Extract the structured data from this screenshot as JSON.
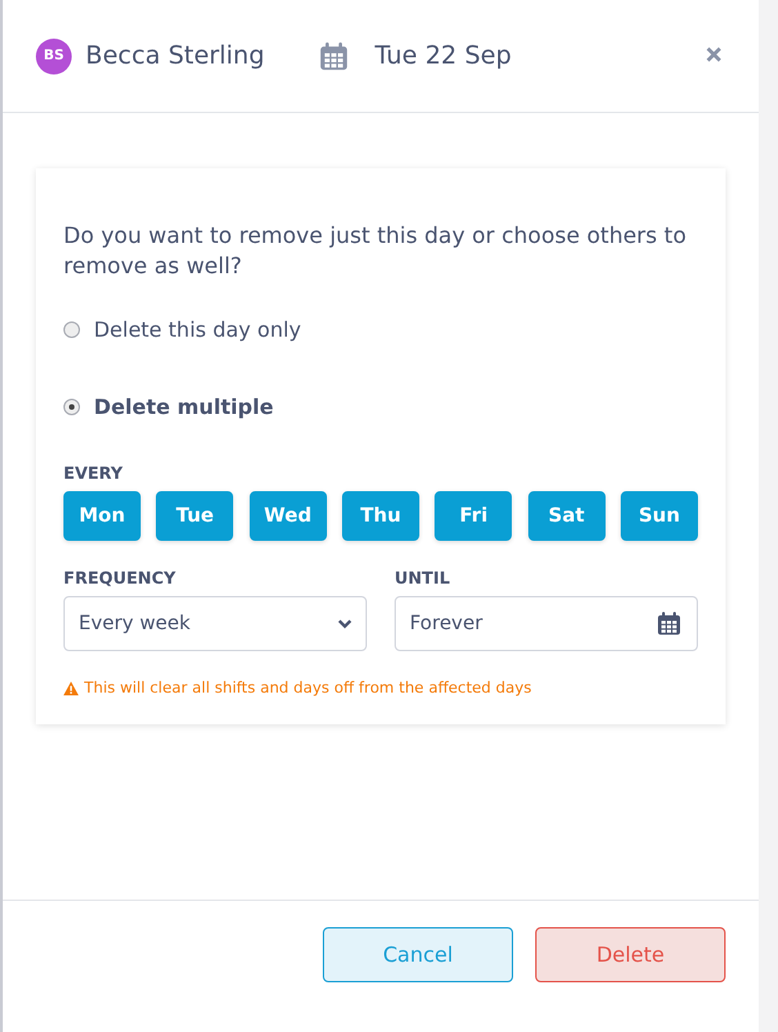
{
  "header": {
    "avatar_initials": "BS",
    "name": "Becca Sterling",
    "date": "Tue 22 Sep"
  },
  "question": "Do you want to remove just this day or choose others to remove as well?",
  "options": [
    {
      "label": "Delete this day only",
      "selected": false
    },
    {
      "label": "Delete multiple",
      "selected": true
    }
  ],
  "every": {
    "label": "EVERY",
    "days": [
      {
        "label": "Mon",
        "selected": true
      },
      {
        "label": "Tue",
        "selected": true
      },
      {
        "label": "Wed",
        "selected": true
      },
      {
        "label": "Thu",
        "selected": true
      },
      {
        "label": "Fri",
        "selected": true
      },
      {
        "label": "Sat",
        "selected": true
      },
      {
        "label": "Sun",
        "selected": true
      }
    ]
  },
  "frequency": {
    "label": "FREQUENCY",
    "value": "Every week"
  },
  "until": {
    "label": "UNTIL",
    "value": "Forever"
  },
  "warning": "This will clear all shifts and days off from the affected days",
  "buttons": [
    {
      "kind": "cancel",
      "label": "Cancel"
    },
    {
      "kind": "delete",
      "label": "Delete"
    }
  ]
}
